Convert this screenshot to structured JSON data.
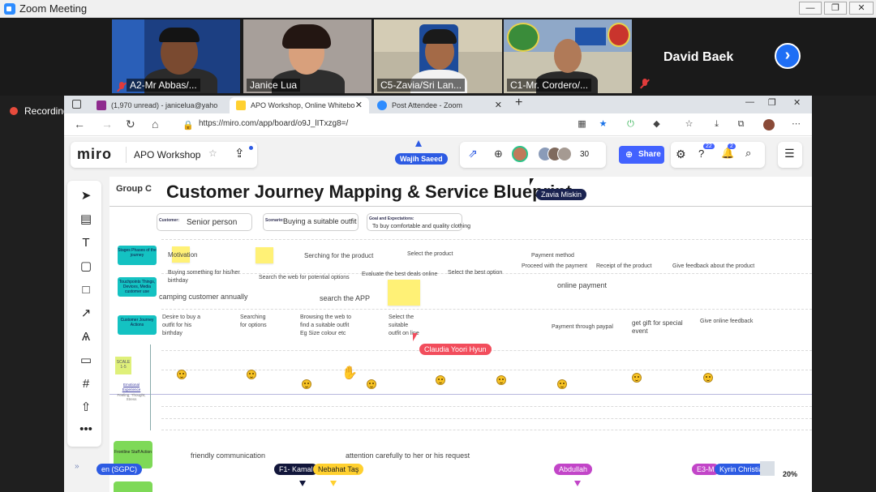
{
  "zoom": {
    "window_title": "Zoom Meeting",
    "participants": [
      {
        "name": "A2-Mr Abbas/...",
        "muted": true
      },
      {
        "name": "Janice Lua",
        "muted": false
      },
      {
        "name": "C5-Zavia/Sri Lan...",
        "muted": false
      },
      {
        "name": "C1-Mr. Cordero/...",
        "muted": false
      }
    ],
    "speaker_name": "David Baek",
    "recording_label": "Recording"
  },
  "browser": {
    "tabs": [
      {
        "label": "(1,970 unread) - janicelua@yaho",
        "active": false
      },
      {
        "label": "APO Workshop, Online Whitebo",
        "active": true
      },
      {
        "label": "Post Attendee - Zoom",
        "active": false
      }
    ],
    "url": "https://miro.com/app/board/o9J_lITxzg8=/"
  },
  "miro": {
    "logo": "miro",
    "board_name": "APO Workshop",
    "top_cursor": "Wajih Saeed",
    "collaborator_count": "30",
    "share_label": "Share",
    "notif_badge_1": "22",
    "notif_badge_2": "2",
    "zoom_level": "20%",
    "group_label": "Group C",
    "board_title": "Customer Journey Mapping & Service Blueprint",
    "customer_label": "Customer:",
    "customer_value": "Senior person",
    "scenario_label": "Scenario:",
    "scenario_value": "Buying a suitable outfit",
    "goal_label": "Goal and Expectations:",
    "goal_value": "To buy comfortable and quality clothing",
    "rows": {
      "stages": "Stages Phases of the journey",
      "touchpoints": "Touchpoints Things, Devices, Media customer use",
      "journey": "Customer Journey Actions",
      "emotional": "Emotional Experience",
      "emotional_sub": "Feeling, Thought, Stress",
      "scale": "SCALE 1-5",
      "frontline": "Frontline Staff Action"
    },
    "stages_texts": [
      "Motivation",
      "Serching  for the product",
      "Select the product",
      "Payment method",
      "Proceed with the payment",
      "Receipt of the product",
      "Give feedback about the product",
      "Select the best option",
      "Evaluate the best deals online"
    ],
    "touch_texts": [
      "Buying something for his/her birthday",
      "Search the web for potential options",
      "camping customer annually",
      "search the APP",
      "online payment"
    ],
    "journey_texts": [
      "Desire to buy a outfit for his birthday",
      "Searching for options",
      "Browsing the web to find a suitable outfit Eg Size colour etc",
      "Select the suitable outfit on line",
      "Payment through paypal",
      "get gift for special event",
      "Give online feedback"
    ],
    "frontline_texts": [
      "friendly communication",
      "attention carefully to her or his request"
    ],
    "cursors": [
      "Zavia Miskin",
      "Claudia Yoori Hyun",
      "en (SGPC)",
      "F1- Kamal",
      "Nebahat Taş",
      "Abdullah",
      "E3-M",
      "Kyrin Christian P"
    ]
  }
}
